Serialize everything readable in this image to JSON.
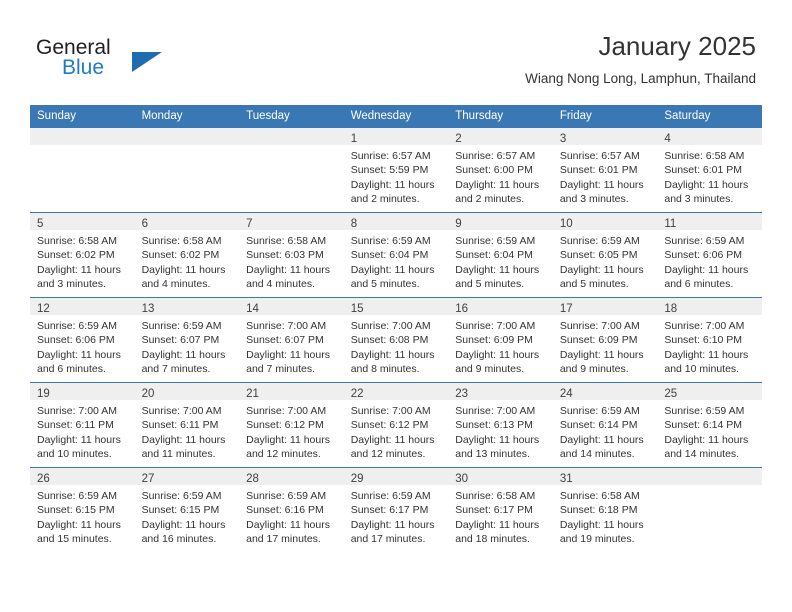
{
  "brand": {
    "word_general": "General",
    "word_blue": "Blue",
    "triangle_color": "#1f6cb0"
  },
  "header": {
    "title": "January 2025",
    "subtitle": "Wiang Nong Long, Lamphun, Thailand",
    "header_bg": "#3a78b5",
    "daynum_band_bg": "#efefef"
  },
  "weekday_headers": [
    "Sunday",
    "Monday",
    "Tuesday",
    "Wednesday",
    "Thursday",
    "Friday",
    "Saturday"
  ],
  "weeks": [
    [
      {
        "day": "",
        "lines": [
          "",
          "",
          "",
          ""
        ]
      },
      {
        "day": "",
        "lines": [
          "",
          "",
          "",
          ""
        ]
      },
      {
        "day": "",
        "lines": [
          "",
          "",
          "",
          ""
        ]
      },
      {
        "day": "1",
        "lines": [
          "Sunrise: 6:57 AM",
          "Sunset: 5:59 PM",
          "Daylight: 11 hours",
          "and 2 minutes."
        ]
      },
      {
        "day": "2",
        "lines": [
          "Sunrise: 6:57 AM",
          "Sunset: 6:00 PM",
          "Daylight: 11 hours",
          "and 2 minutes."
        ]
      },
      {
        "day": "3",
        "lines": [
          "Sunrise: 6:57 AM",
          "Sunset: 6:01 PM",
          "Daylight: 11 hours",
          "and 3 minutes."
        ]
      },
      {
        "day": "4",
        "lines": [
          "Sunrise: 6:58 AM",
          "Sunset: 6:01 PM",
          "Daylight: 11 hours",
          "and 3 minutes."
        ]
      }
    ],
    [
      {
        "day": "5",
        "lines": [
          "Sunrise: 6:58 AM",
          "Sunset: 6:02 PM",
          "Daylight: 11 hours",
          "and 3 minutes."
        ]
      },
      {
        "day": "6",
        "lines": [
          "Sunrise: 6:58 AM",
          "Sunset: 6:02 PM",
          "Daylight: 11 hours",
          "and 4 minutes."
        ]
      },
      {
        "day": "7",
        "lines": [
          "Sunrise: 6:58 AM",
          "Sunset: 6:03 PM",
          "Daylight: 11 hours",
          "and 4 minutes."
        ]
      },
      {
        "day": "8",
        "lines": [
          "Sunrise: 6:59 AM",
          "Sunset: 6:04 PM",
          "Daylight: 11 hours",
          "and 5 minutes."
        ]
      },
      {
        "day": "9",
        "lines": [
          "Sunrise: 6:59 AM",
          "Sunset: 6:04 PM",
          "Daylight: 11 hours",
          "and 5 minutes."
        ]
      },
      {
        "day": "10",
        "lines": [
          "Sunrise: 6:59 AM",
          "Sunset: 6:05 PM",
          "Daylight: 11 hours",
          "and 5 minutes."
        ]
      },
      {
        "day": "11",
        "lines": [
          "Sunrise: 6:59 AM",
          "Sunset: 6:06 PM",
          "Daylight: 11 hours",
          "and 6 minutes."
        ]
      }
    ],
    [
      {
        "day": "12",
        "lines": [
          "Sunrise: 6:59 AM",
          "Sunset: 6:06 PM",
          "Daylight: 11 hours",
          "and 6 minutes."
        ]
      },
      {
        "day": "13",
        "lines": [
          "Sunrise: 6:59 AM",
          "Sunset: 6:07 PM",
          "Daylight: 11 hours",
          "and 7 minutes."
        ]
      },
      {
        "day": "14",
        "lines": [
          "Sunrise: 7:00 AM",
          "Sunset: 6:07 PM",
          "Daylight: 11 hours",
          "and 7 minutes."
        ]
      },
      {
        "day": "15",
        "lines": [
          "Sunrise: 7:00 AM",
          "Sunset: 6:08 PM",
          "Daylight: 11 hours",
          "and 8 minutes."
        ]
      },
      {
        "day": "16",
        "lines": [
          "Sunrise: 7:00 AM",
          "Sunset: 6:09 PM",
          "Daylight: 11 hours",
          "and 9 minutes."
        ]
      },
      {
        "day": "17",
        "lines": [
          "Sunrise: 7:00 AM",
          "Sunset: 6:09 PM",
          "Daylight: 11 hours",
          "and 9 minutes."
        ]
      },
      {
        "day": "18",
        "lines": [
          "Sunrise: 7:00 AM",
          "Sunset: 6:10 PM",
          "Daylight: 11 hours",
          "and 10 minutes."
        ]
      }
    ],
    [
      {
        "day": "19",
        "lines": [
          "Sunrise: 7:00 AM",
          "Sunset: 6:11 PM",
          "Daylight: 11 hours",
          "and 10 minutes."
        ]
      },
      {
        "day": "20",
        "lines": [
          "Sunrise: 7:00 AM",
          "Sunset: 6:11 PM",
          "Daylight: 11 hours",
          "and 11 minutes."
        ]
      },
      {
        "day": "21",
        "lines": [
          "Sunrise: 7:00 AM",
          "Sunset: 6:12 PM",
          "Daylight: 11 hours",
          "and 12 minutes."
        ]
      },
      {
        "day": "22",
        "lines": [
          "Sunrise: 7:00 AM",
          "Sunset: 6:12 PM",
          "Daylight: 11 hours",
          "and 12 minutes."
        ]
      },
      {
        "day": "23",
        "lines": [
          "Sunrise: 7:00 AM",
          "Sunset: 6:13 PM",
          "Daylight: 11 hours",
          "and 13 minutes."
        ]
      },
      {
        "day": "24",
        "lines": [
          "Sunrise: 6:59 AM",
          "Sunset: 6:14 PM",
          "Daylight: 11 hours",
          "and 14 minutes."
        ]
      },
      {
        "day": "25",
        "lines": [
          "Sunrise: 6:59 AM",
          "Sunset: 6:14 PM",
          "Daylight: 11 hours",
          "and 14 minutes."
        ]
      }
    ],
    [
      {
        "day": "26",
        "lines": [
          "Sunrise: 6:59 AM",
          "Sunset: 6:15 PM",
          "Daylight: 11 hours",
          "and 15 minutes."
        ]
      },
      {
        "day": "27",
        "lines": [
          "Sunrise: 6:59 AM",
          "Sunset: 6:15 PM",
          "Daylight: 11 hours",
          "and 16 minutes."
        ]
      },
      {
        "day": "28",
        "lines": [
          "Sunrise: 6:59 AM",
          "Sunset: 6:16 PM",
          "Daylight: 11 hours",
          "and 17 minutes."
        ]
      },
      {
        "day": "29",
        "lines": [
          "Sunrise: 6:59 AM",
          "Sunset: 6:17 PM",
          "Daylight: 11 hours",
          "and 17 minutes."
        ]
      },
      {
        "day": "30",
        "lines": [
          "Sunrise: 6:58 AM",
          "Sunset: 6:17 PM",
          "Daylight: 11 hours",
          "and 18 minutes."
        ]
      },
      {
        "day": "31",
        "lines": [
          "Sunrise: 6:58 AM",
          "Sunset: 6:18 PM",
          "Daylight: 11 hours",
          "and 19 minutes."
        ]
      },
      {
        "day": "",
        "lines": [
          "",
          "",
          "",
          ""
        ]
      }
    ]
  ]
}
